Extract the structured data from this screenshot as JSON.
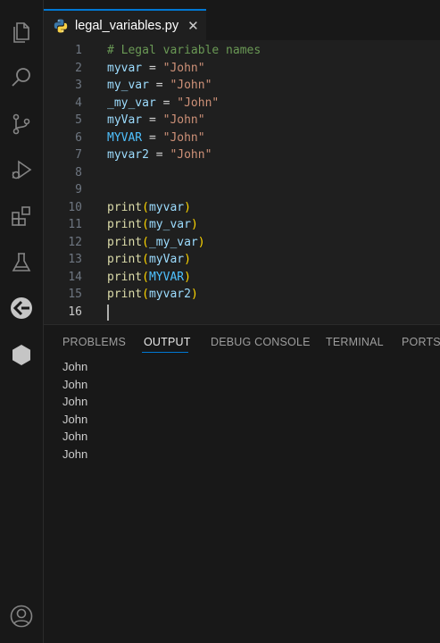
{
  "activity_bar": {
    "icons": [
      "files-icon",
      "search-icon",
      "source-control-icon",
      "run-debug-icon",
      "extensions-icon",
      "testing-icon",
      "remote-explorer-icon",
      "hexagon-icon",
      "account-icon"
    ]
  },
  "tab": {
    "filename": "legal_variables.py",
    "close_glyph": "✕"
  },
  "editor": {
    "lines": [
      {
        "num": "1",
        "tokens": [
          {
            "t": "# Legal variable names",
            "c": "comment"
          }
        ]
      },
      {
        "num": "2",
        "tokens": [
          {
            "t": "myvar",
            "c": "var"
          },
          {
            "t": " = ",
            "c": "op"
          },
          {
            "t": "\"John\"",
            "c": "str"
          }
        ]
      },
      {
        "num": "3",
        "tokens": [
          {
            "t": "my_var",
            "c": "var"
          },
          {
            "t": " = ",
            "c": "op"
          },
          {
            "t": "\"John\"",
            "c": "str"
          }
        ]
      },
      {
        "num": "4",
        "tokens": [
          {
            "t": "_my_var",
            "c": "var"
          },
          {
            "t": " = ",
            "c": "op"
          },
          {
            "t": "\"John\"",
            "c": "str"
          }
        ]
      },
      {
        "num": "5",
        "tokens": [
          {
            "t": "myVar",
            "c": "var"
          },
          {
            "t": " = ",
            "c": "op"
          },
          {
            "t": "\"John\"",
            "c": "str"
          }
        ]
      },
      {
        "num": "6",
        "tokens": [
          {
            "t": "MYVAR",
            "c": "const"
          },
          {
            "t": " = ",
            "c": "op"
          },
          {
            "t": "\"John\"",
            "c": "str"
          }
        ]
      },
      {
        "num": "7",
        "tokens": [
          {
            "t": "myvar2",
            "c": "var"
          },
          {
            "t": " = ",
            "c": "op"
          },
          {
            "t": "\"John\"",
            "c": "str"
          }
        ]
      },
      {
        "num": "8",
        "tokens": []
      },
      {
        "num": "9",
        "tokens": []
      },
      {
        "num": "10",
        "tokens": [
          {
            "t": "print",
            "c": "fn"
          },
          {
            "t": "(",
            "c": "paren"
          },
          {
            "t": "myvar",
            "c": "var"
          },
          {
            "t": ")",
            "c": "paren"
          }
        ]
      },
      {
        "num": "11",
        "tokens": [
          {
            "t": "print",
            "c": "fn"
          },
          {
            "t": "(",
            "c": "paren"
          },
          {
            "t": "my_var",
            "c": "var"
          },
          {
            "t": ")",
            "c": "paren"
          }
        ]
      },
      {
        "num": "12",
        "tokens": [
          {
            "t": "print",
            "c": "fn"
          },
          {
            "t": "(",
            "c": "paren"
          },
          {
            "t": "_my_var",
            "c": "var"
          },
          {
            "t": ")",
            "c": "paren"
          }
        ]
      },
      {
        "num": "13",
        "tokens": [
          {
            "t": "print",
            "c": "fn"
          },
          {
            "t": "(",
            "c": "paren"
          },
          {
            "t": "myVar",
            "c": "var"
          },
          {
            "t": ")",
            "c": "paren"
          }
        ]
      },
      {
        "num": "14",
        "tokens": [
          {
            "t": "print",
            "c": "fn"
          },
          {
            "t": "(",
            "c": "paren"
          },
          {
            "t": "MYVAR",
            "c": "const"
          },
          {
            "t": ")",
            "c": "paren"
          }
        ]
      },
      {
        "num": "15",
        "tokens": [
          {
            "t": "print",
            "c": "fn"
          },
          {
            "t": "(",
            "c": "paren"
          },
          {
            "t": "myvar2",
            "c": "var"
          },
          {
            "t": ")",
            "c": "paren"
          }
        ]
      },
      {
        "num": "16",
        "tokens": [],
        "active": true
      }
    ]
  },
  "panel": {
    "tabs": [
      {
        "label": "PROBLEMS",
        "active": false
      },
      {
        "label": "OUTPUT",
        "active": true
      },
      {
        "label": "DEBUG CONSOLE",
        "active": false
      },
      {
        "label": "TERMINAL",
        "active": false
      },
      {
        "label": "PORTS",
        "active": false
      }
    ],
    "output_lines": [
      "John",
      "John",
      "John",
      "John",
      "John",
      "John"
    ]
  },
  "colors": {
    "accent": "#0078d4",
    "comment": "#6a9955",
    "string": "#ce9178",
    "variable": "#9cdcfe",
    "function": "#dcdcaa"
  }
}
